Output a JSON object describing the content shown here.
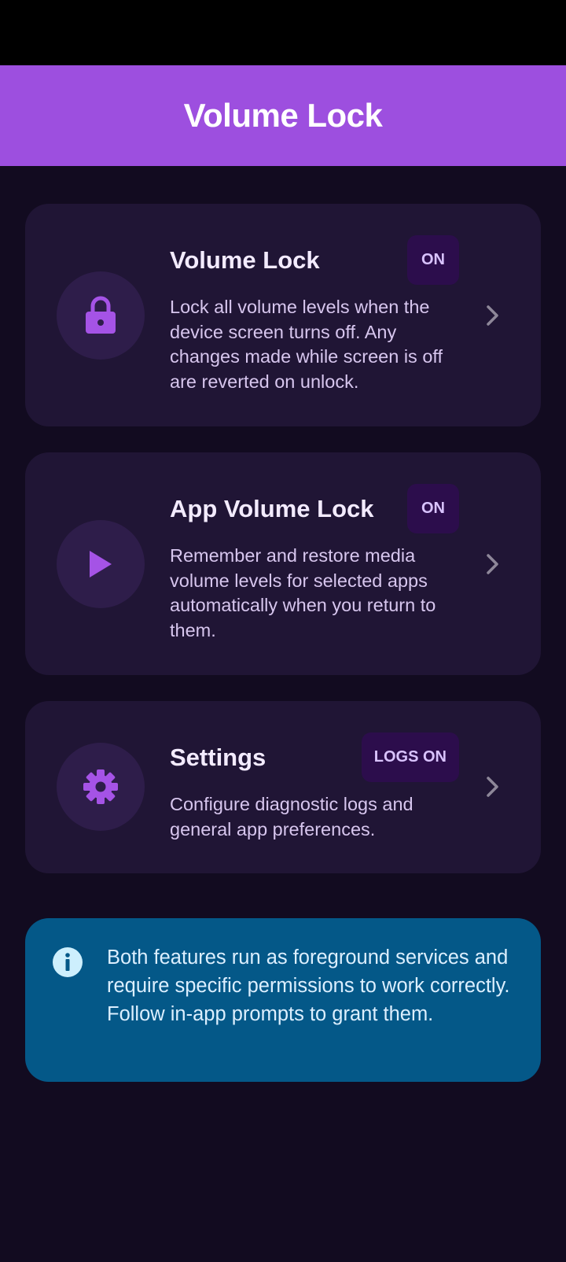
{
  "app_bar": {
    "title": "Volume Lock"
  },
  "cards": [
    {
      "icon": "lock-icon",
      "title": "Volume Lock",
      "badge": "ON",
      "description": "Lock all volume levels when the device screen turns off. Any changes made while screen is off are reverted on unlock."
    },
    {
      "icon": "play-icon",
      "title": "App Volume Lock",
      "badge": "ON",
      "description": "Remember and restore media volume levels for selected apps automatically when you return to them."
    },
    {
      "icon": "gear-icon",
      "title": "Settings",
      "badge": "LOGS ON",
      "description": "Configure diagnostic logs and general app preferences."
    }
  ],
  "info": {
    "icon": "info-icon",
    "text": "Both features run as foreground services and require specific permissions to work correctly. Follow in-app prompts to grant them."
  },
  "colors": {
    "accent": "#9d4fdf",
    "background": "#120b20",
    "card": "#201535",
    "info_background": "#045888"
  }
}
